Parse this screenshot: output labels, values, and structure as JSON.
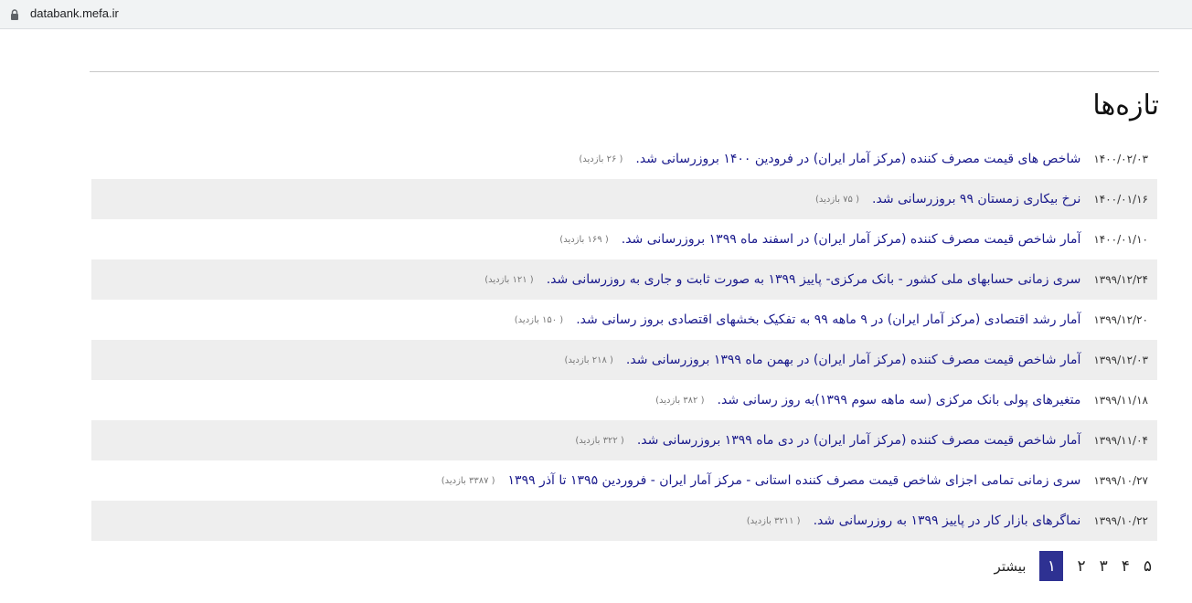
{
  "browser": {
    "url": "databank.mefa.ir"
  },
  "page": {
    "title": "تازه‌ها"
  },
  "news": [
    {
      "date": "۱۴۰۰/۰۲/۰۳",
      "text": "شاخص های قیمت مصرف کننده (مرکز آمار ایران) در فرودین ۱۴۰۰ بروزرسانی شد.",
      "views": "( ۲۶ بازدید)"
    },
    {
      "date": "۱۴۰۰/۰۱/۱۶",
      "text": "نرخ بیکاری زمستان ۹۹ بروزرسانی شد.",
      "views": "( ۷۵ بازدید)"
    },
    {
      "date": "۱۴۰۰/۰۱/۱۰",
      "text": "آمار شاخص قیمت مصرف کننده (مرکز آمار ایران) در اسفند ماه ۱۳۹۹ بروزرسانی شد.",
      "views": "( ۱۶۹ بازدید)"
    },
    {
      "date": "۱۳۹۹/۱۲/۲۴",
      "text": "سری زمانی حسابهای ملی کشور - بانک مرکزی- پاییز ۱۳۹۹ به صورت ثابت و جاری به روزرسانی شد.",
      "views": "( ۱۲۱ بازدید)"
    },
    {
      "date": "۱۳۹۹/۱۲/۲۰",
      "text": "آمار رشد اقتصادی (مرکز آمار ایران) در ۹ ماهه ۹۹ به تفکیک بخشهای اقتصادی بروز رسانی شد.",
      "views": "( ۱۵۰ بازدید)"
    },
    {
      "date": "۱۳۹۹/۱۲/۰۳",
      "text": "آمار شاخص قیمت مصرف کننده (مرکز آمار ایران) در بهمن ماه ۱۳۹۹ بروزرسانی شد.",
      "views": "( ۲۱۸ بازدید)"
    },
    {
      "date": "۱۳۹۹/۱۱/۱۸",
      "text": "متغیرهای پولی بانک مرکزی (سه ماهه سوم ۱۳۹۹)به روز رسانی شد.",
      "views": "( ۳۸۲ بازدید)"
    },
    {
      "date": "۱۳۹۹/۱۱/۰۴",
      "text": "آمار شاخص قیمت مصرف کننده (مرکز آمار ایران) در دی ماه ۱۳۹۹ بروزرسانی شد.",
      "views": "( ۳۲۲ بازدید)"
    },
    {
      "date": "۱۳۹۹/۱۰/۲۷",
      "text": "سری زمانی تمامی اجزای شاخص قیمت مصرف کننده استانی - مرکز آمار ایران - فروردین ۱۳۹۵ تا آذر ۱۳۹۹",
      "views": "( ۳۳۸۷ بازدید)"
    },
    {
      "date": "۱۳۹۹/۱۰/۲۲",
      "text": "نماگرهای بازار کار در پاییز ۱۳۹۹ به روزرسانی شد.",
      "views": "( ۳۲۱۱ بازدید)"
    }
  ],
  "pagination": {
    "pages": [
      "۱",
      "۲",
      "۳",
      "۴",
      "۵"
    ],
    "active": "۱",
    "more_label": "بیشتر"
  },
  "colors": {
    "link": "#1a1a8c",
    "active_page": "#2e3192",
    "stripe": "#eeeeee"
  }
}
